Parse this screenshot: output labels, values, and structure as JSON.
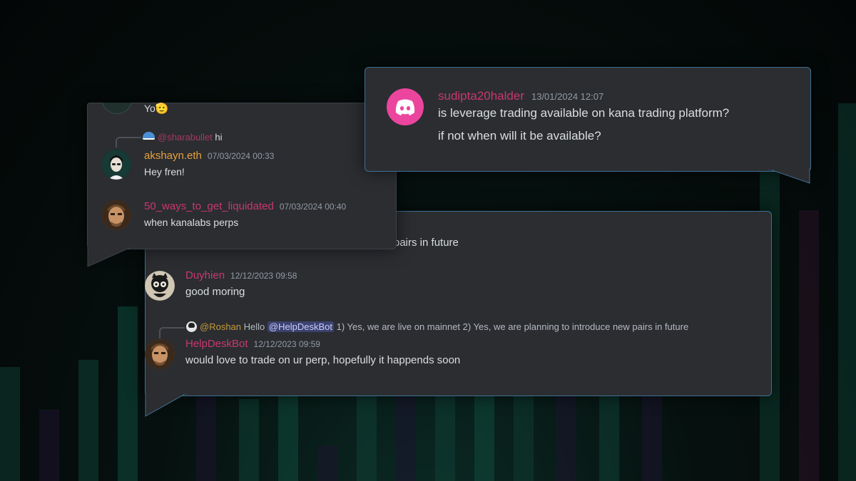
{
  "colors": {
    "pink": "#c9386e",
    "orange": "#e8a13a",
    "discord_pink": "#eb459e",
    "text": "#dbdee1",
    "muted": "#949ba4"
  },
  "card_top": {
    "icon": "discord-logo-icon",
    "username": "sudipta20halder",
    "timestamp": "13/01/2024 12:07",
    "line1": "is leverage trading available on kana trading platform?",
    "line2": "if not when will it be available?"
  },
  "card_left": {
    "partial_text": "Yo",
    "partial_emoji": "🫡",
    "reply": {
      "icon": "sneaker-icon",
      "mention": "@sharabullet",
      "text": "hi"
    },
    "messages": [
      {
        "username": "akshayn.eth",
        "timestamp": "07/03/2024 00:33",
        "text": "Hey fren!"
      },
      {
        "username": "50_ways_to_get_liquidated",
        "timestamp": "07/03/2024 00:40",
        "text": "when kanalabs perps"
      }
    ]
  },
  "card_main": {
    "partial_line": "w pairs in future",
    "messages": [
      {
        "username": "Duyhien",
        "timestamp": "12/12/2023 09:58",
        "text": "good moring"
      },
      {
        "username": "HelpDeskBot",
        "timestamp": "12/12/2023 09:59",
        "text": "would love to trade on ur perp, hopefully it happends soon"
      }
    ],
    "reply": {
      "mention": "@Roshan",
      "prefix": "Hello",
      "tag": "@HelpDeskBot",
      "text": "1) Yes, we are live on mainnet 2) Yes, we are planning to introduce new pairs in future"
    }
  }
}
